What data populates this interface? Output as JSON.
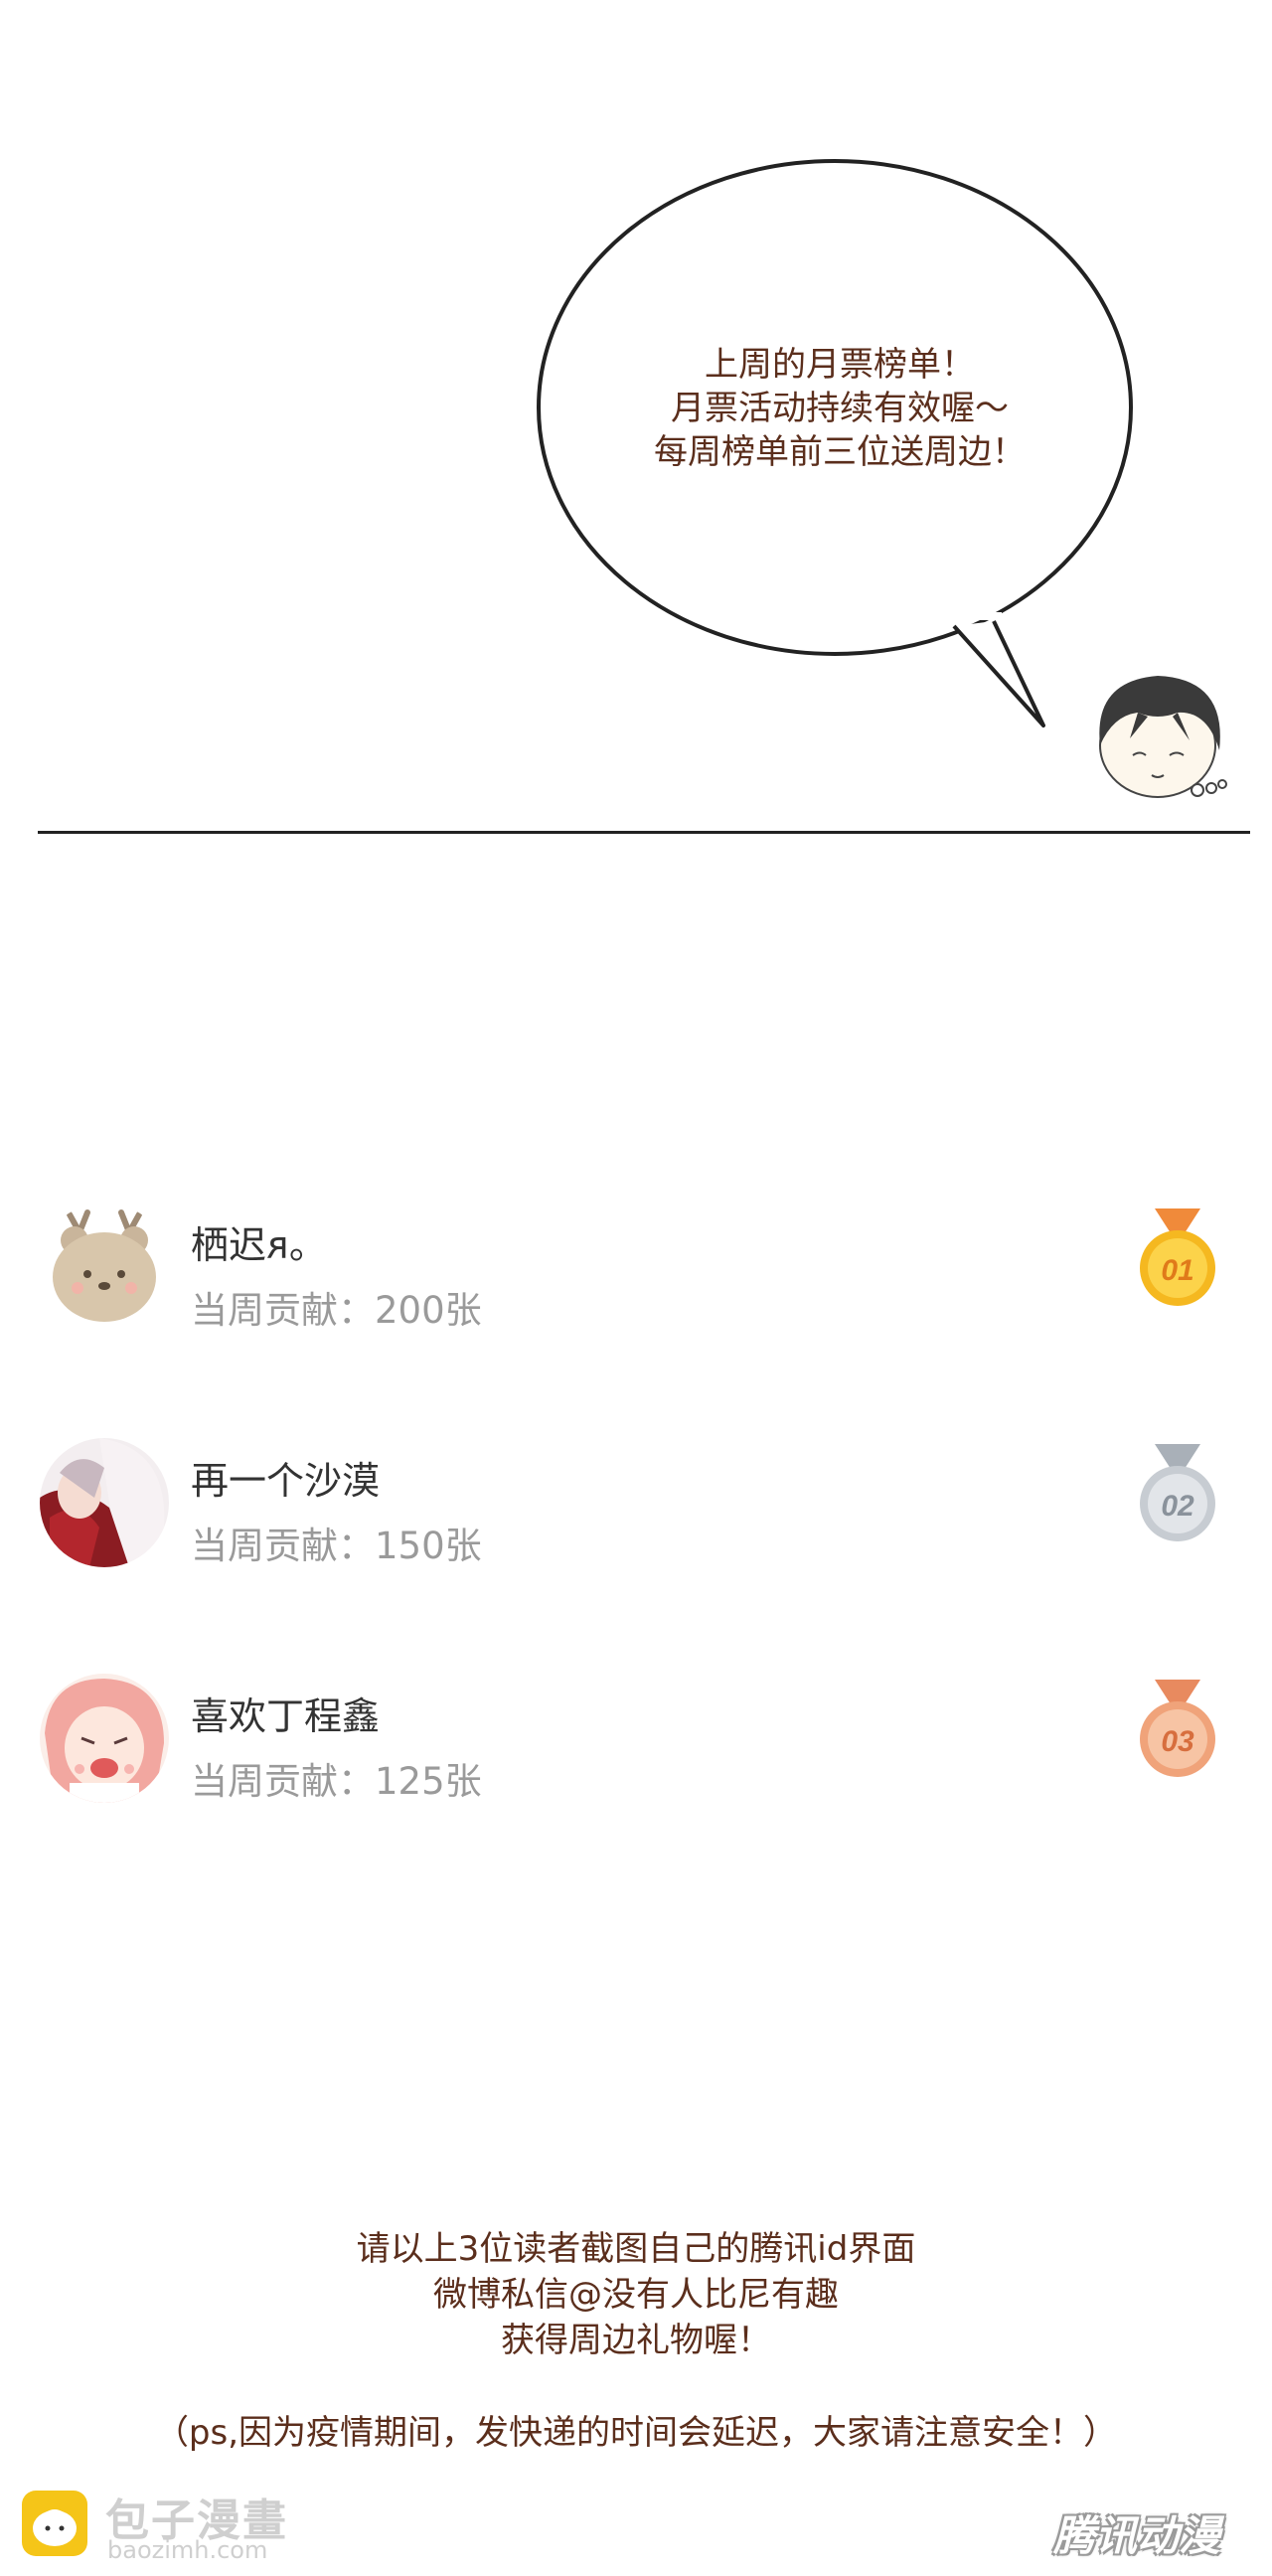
{
  "bubble": {
    "lines": [
      "上周的月票榜单！",
      "月票活动持续有效喔～",
      "每周榜单前三位送周边！"
    ]
  },
  "ranking": [
    {
      "name": "栖迟ᴙ。",
      "contribution": "当周贡献：200张",
      "medal": "01",
      "medal_color": "#f5b820"
    },
    {
      "name": "再一个沙漠",
      "contribution": "当周贡献：150张",
      "medal": "02",
      "medal_color": "#c7ccd2"
    },
    {
      "name": "喜欢丁程鑫",
      "contribution": "当周贡献：125张",
      "medal": "03",
      "medal_color": "#f0a37a"
    }
  ],
  "footer": {
    "lines": [
      "请以上3位读者截图自己的腾讯id界面",
      "微博私信@没有人比尼有趣",
      "获得周边礼物喔！"
    ],
    "ps": "（ps,因为疫情期间，发快递的时间会延迟，大家请注意安全！）"
  },
  "watermark": {
    "site_name": "包子漫畫",
    "site_url": "baozimh.com",
    "brand": "腾讯动漫"
  },
  "colors": {
    "text_brown": "#5b2e1c",
    "medal_gold": "#f5b820",
    "medal_silver": "#c7ccd2",
    "medal_bronze": "#f0a37a"
  }
}
